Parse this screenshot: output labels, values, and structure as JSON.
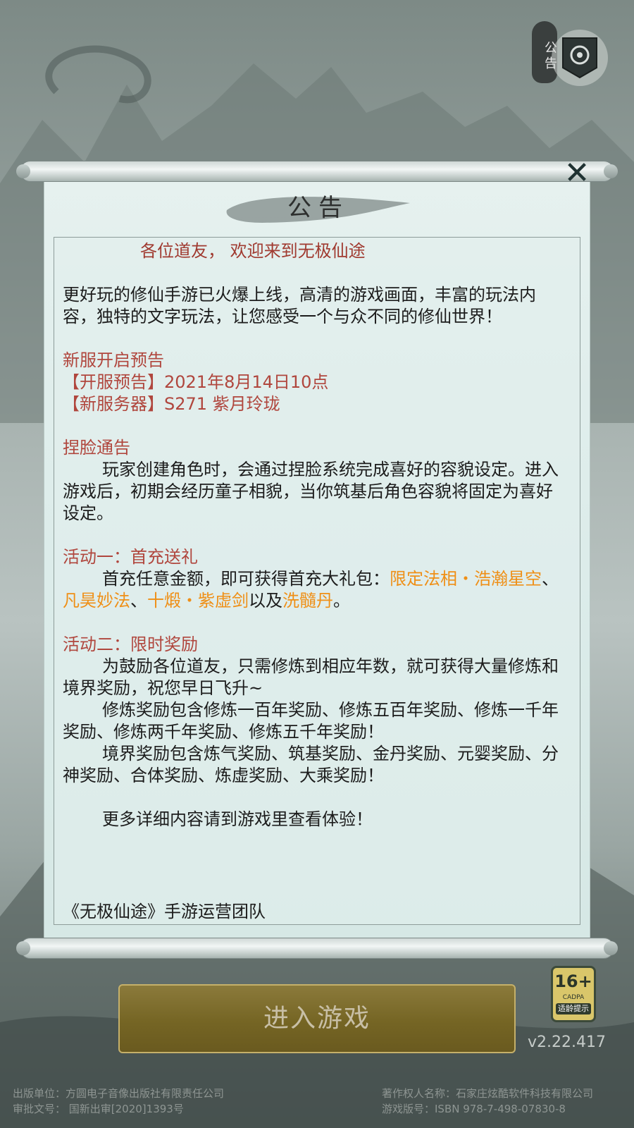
{
  "notice_badge": {
    "label": "公告"
  },
  "dialog": {
    "title": "公告",
    "close_icon": "✕",
    "greeting": "各位道友，  欢迎来到无极仙途",
    "intro": "更好玩的修仙手游已火爆上线，高清的游戏画面，丰富的玩法内容，独特的文字玩法，让您感受一个与众不同的修仙世界！",
    "server_heading": "新服开启预告",
    "server_time": "【开服预告】2021年8月14日10点",
    "server_name": "【新服务器】S271 紫月玲珑",
    "face_heading": "捏脸通告",
    "face_body": "玩家创建角色时，会通过捏脸系统完成喜好的容貌设定。进入游戏后，初期会经历童子相貌，当你筑基后角色容貌将固定为喜好设定。",
    "event1_heading": "活动一：首充送礼",
    "event1_pre": "首充任意金额，即可获得首充大礼包：",
    "event1_item1": "限定法相・浩瀚星空",
    "sep1": "、",
    "event1_item2": "凡昊妙法",
    "sep2": "、",
    "event1_item3": "十煅・紫虚剑",
    "event1_mid": "以及",
    "event1_item4": "洗髓丹",
    "event1_end": "。",
    "event2_heading": "活动二：限时奖励",
    "event2_p1": "为鼓励各位道友，只需修炼到相应年数，就可获得大量修炼和境界奖励，祝您早日飞升~",
    "event2_p2": "修炼奖励包含修炼一百年奖励、修炼五百年奖励、修炼一千年奖励、修炼两千年奖励、修炼五千年奖励！",
    "event2_p3": "境界奖励包含炼气奖励、筑基奖励、金丹奖励、元婴奖励、分神奖励、合体奖励、炼虚奖励、大乘奖励！",
    "more": "更多详细内容请到游戏里查看体验！",
    "signature": "《无极仙途》手游运营团队"
  },
  "enter_button": {
    "label": "进入游戏"
  },
  "age_rating": {
    "age": "16+",
    "org": "CADPA",
    "tip": "适龄提示"
  },
  "version": "v2.22.417",
  "footer": {
    "publisher": "出版单位：方圆电子音像出版社有限责任公司",
    "approval": "审批文号： 国新出审[2020]1393号",
    "copyright": "著作权人名称：石家庄炫酷软件科技有限公司",
    "isbn": "游戏版号：ISBN 978-7-498-07830-8"
  }
}
